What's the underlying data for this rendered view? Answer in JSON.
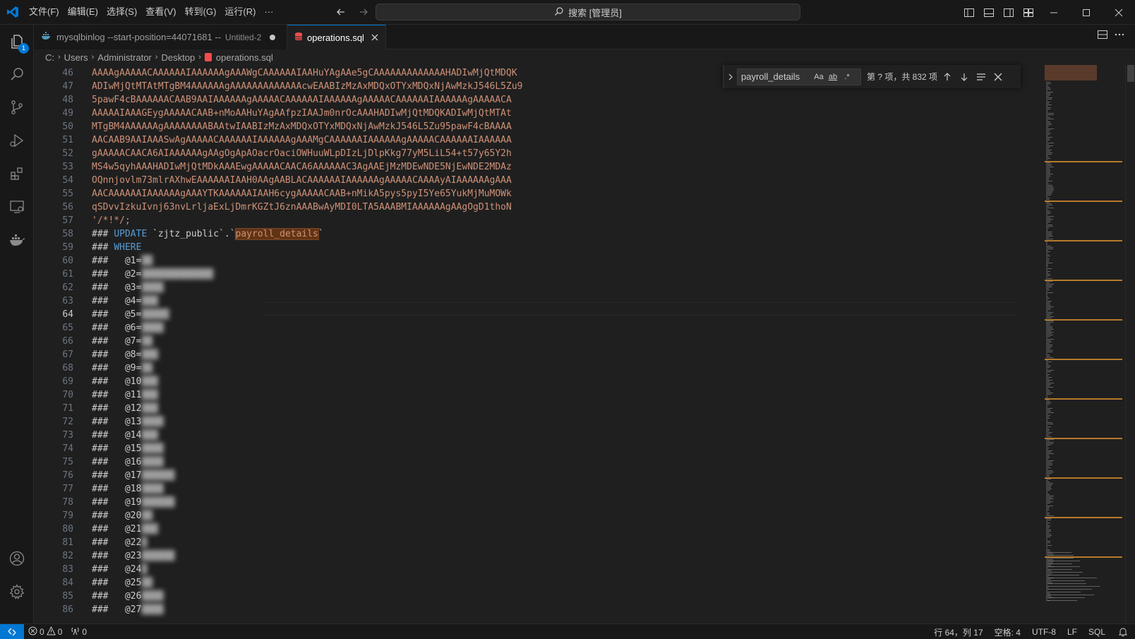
{
  "titlebar": {
    "menu": [
      "文件(F)",
      "编辑(E)",
      "选择(S)",
      "查看(V)",
      "转到(G)",
      "运行(R)",
      "···"
    ],
    "search_label": "搜索 [管理员]"
  },
  "activitybar": {
    "explorer_badge": "1"
  },
  "tabs": [
    {
      "label": "mysqlbinlog --start-position=44071681 --",
      "description": "Untitled-2",
      "dirty": true
    },
    {
      "label": "operations.sql",
      "active": true
    }
  ],
  "breadcrumb": [
    "C:",
    "Users",
    "Administrator",
    "Desktop",
    "operations.sql"
  ],
  "editor": {
    "line_numbers": [
      "46",
      "47",
      "48",
      "49",
      "50",
      "51",
      "52",
      "53",
      "54",
      "55",
      "56",
      "57",
      "58",
      "59",
      "60",
      "61",
      "62",
      "63",
      "64",
      "65",
      "66",
      "67",
      "68",
      "69",
      "70",
      "71",
      "72",
      "73",
      "74",
      "75",
      "76",
      "77",
      "78",
      "79",
      "80",
      "81",
      "82",
      "83",
      "84",
      "85",
      "86"
    ],
    "current_line": "64",
    "base64_lines": [
      "AAAAgAAAAACAAAAAAIAAAAAAgAAAWgCAAAAAAIAAHuYAgAAe5gCAAAAAAAAAAAAAHADIwMjQtMDQK",
      "ADIwMjQtMTAtMTgBM4AAAAAAgAAAAAAAAAAAAAcwEAABIzMzAxMDQxOTYxMDQxNjAwMzkJ546L5Zu9",
      "5pawF4cBAAAAAACAAB9AAIAAAAAAgAAAAACAAAAAAIAAAAAAgAAAAACAAAAAAIAAAAAAgAAAAACA",
      "AAAAAIAAAGEygAAAAACAAB+nMoAAHuYAgAAfpzIAAJm0nrOcAAAHADIwMjQtMDQKADIwMjQtMTAt",
      "MTgBM4AAAAAAgAAAAAAAABAAtwIAABIzMzAxMDQxOTYxMDQxNjAwMzkJ546L5Zu95pawF4cBAAAA",
      "AACAAB9AAIAAASwAgAAAAACAAAAAAIAAAAAAgAAAMgCAAAAAAIAAAAAAgAAAAACAAAAAAIAAAAAA",
      "gAAAAACAACA6AIAAAAAAgAAgOgApAOacrOaciOWHuuWLpDIzLjDlpKkg77yM5LiL54+t57y65Y2h",
      "MS4w5qyhAAAHADIwMjQtMDkAAAEwgAAAAACAACA6AAAAAAC3AgAAEjMzMDEwNDE5NjEwNDE2MDAz",
      "OQnnjovlm73mlrAXhwEAAAAAAIAAH0AAgAABLACAAAAAAIAAAAAAgAAAAACAAAAyAIAAAAAAgAAA",
      "AACAAAAAAIAAAAAAgAAAYTKAAAAAAIAAH6cygAAAAACAAB+nMikA5pys5pyI5Ye65YukMjMuMOWk",
      "qSDvvIzkuIvnj63nvLrljaExLjDmrKGZtJ6znAAABwAyMDI0LTA5AAABMIAAAAAAgAAgOgD1thoN"
    ],
    "end_line": "'/*!*/;",
    "update_prefix": "### ",
    "update_kw": "UPDATE",
    "update_schema": " `zjtz_public`.`",
    "update_table": "payroll_details",
    "update_suffix": "`",
    "where_prefix": "### ",
    "where_kw": "WHERE",
    "params": [
      "@1=",
      "@2=",
      "@3=",
      "@4=",
      "@5=",
      "@6=",
      "@7=",
      "@8=",
      "@9=",
      "@10",
      "@11",
      "@12",
      "@13",
      "@14",
      "@15",
      "@16",
      "@17",
      "@18",
      "@19",
      "@20",
      "@21",
      "@22",
      "@23",
      "@24",
      "@25",
      "@26",
      "@27"
    ]
  },
  "find": {
    "query": "payroll_details",
    "case_label": "Aa",
    "word_label": "ab",
    "regex_label": ".*",
    "count": "第 ? 项，共 832 项"
  },
  "statusbar": {
    "errors": "0",
    "warnings": "0",
    "ports": "0",
    "position": "行 64，列 17",
    "indent": "空格: 4",
    "encoding": "UTF-8",
    "eol": "LF",
    "language": "SQL"
  },
  "colors": {
    "accent": "#0078d4",
    "string": "#ce9178",
    "keyword": "#569cd6",
    "match_highlight": "#623315"
  }
}
